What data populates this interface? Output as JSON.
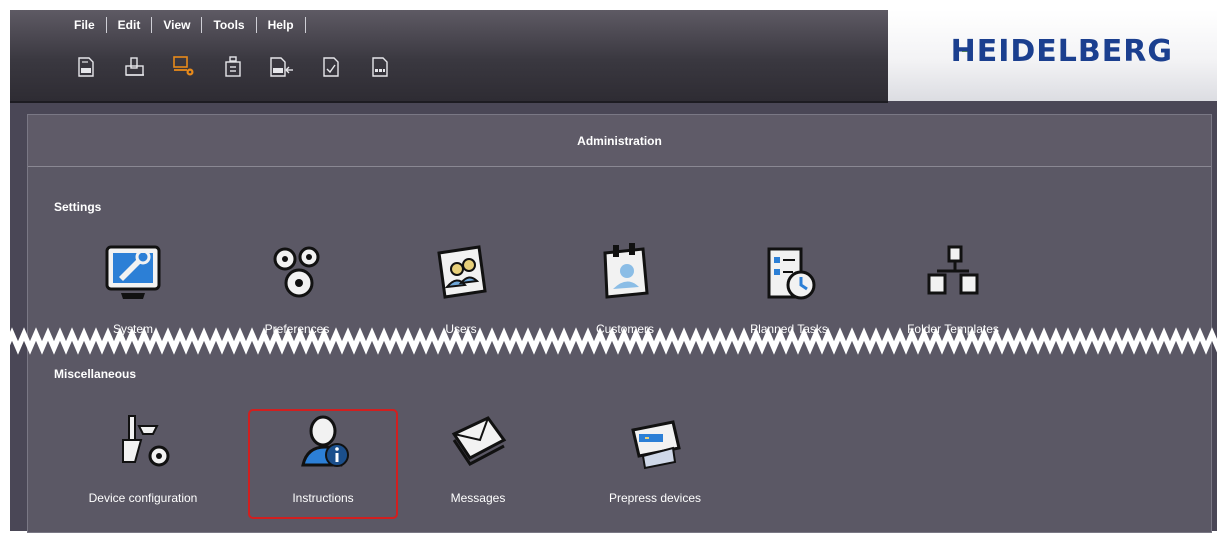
{
  "menu": {
    "items": [
      "File",
      "Edit",
      "View",
      "Tools",
      "Help"
    ]
  },
  "toolbar": {
    "icons": [
      "document-abc-icon",
      "printer-icon",
      "admin-monitor-icon",
      "tool-icon",
      "document-abc-arrow-icon",
      "document-check-icon",
      "document-grid-icon"
    ]
  },
  "brand": {
    "logo_text": "HEIDELBERG"
  },
  "panel": {
    "title": "Administration"
  },
  "sections": {
    "settings": {
      "title": "Settings",
      "tiles": [
        {
          "label": "System"
        },
        {
          "label": "Preferences"
        },
        {
          "label": "Users"
        },
        {
          "label": "Customers"
        },
        {
          "label": "Planned Tasks"
        },
        {
          "label": "Folder Templates"
        }
      ]
    },
    "misc": {
      "title": "Miscellaneous",
      "tiles": [
        {
          "label": "Device configuration"
        },
        {
          "label": "Instructions"
        },
        {
          "label": "Messages"
        },
        {
          "label": "Prepress devices"
        }
      ]
    }
  },
  "colors": {
    "background": "#4a4756",
    "panel": "#5b5865",
    "accent_orange": "#e88a1a",
    "selection_red": "#d11f1f",
    "brand_blue": "#1b3f8f",
    "brand_green": "#7fbf27"
  }
}
